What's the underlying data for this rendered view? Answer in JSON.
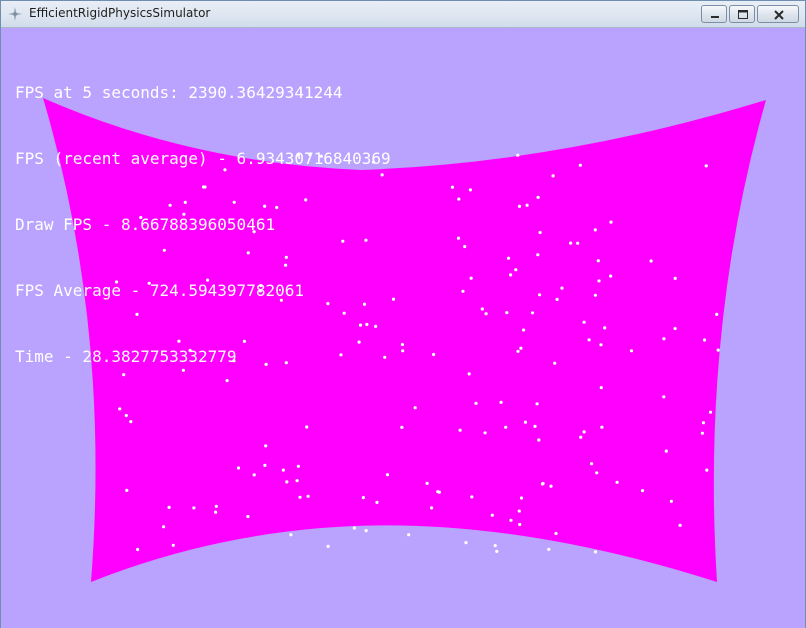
{
  "window": {
    "title": "EfficientRigidPhysicsSimulator"
  },
  "hud": {
    "lines": [
      "FPS at 5 seconds: 2390.36429341244",
      "FPS (recent average) - 6.93430716840369",
      "Draw FPS - 8.66788396050461",
      "FPS Average - 724.594397782061",
      "Time - 28.3827753332779"
    ]
  },
  "colors": {
    "background": "#b9a3ff",
    "cloth": "#ff00ff",
    "particles": "#ffffff",
    "hud_text": "#ffffff"
  },
  "icons": {
    "app": "app-icon",
    "minimize": "minimize-icon",
    "maximize": "maximize-icon",
    "close": "close-icon"
  }
}
